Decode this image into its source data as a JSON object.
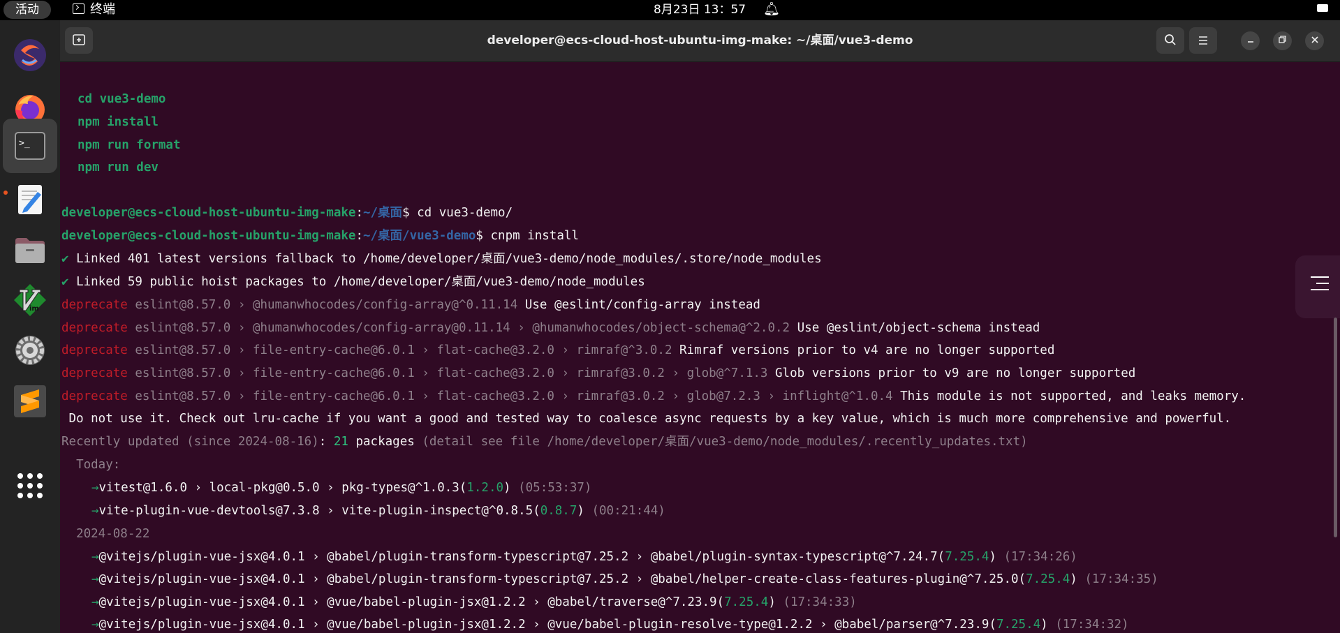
{
  "topbar": {
    "activities": "活动",
    "app_name": "终端",
    "clock": "8月23日  13：57"
  },
  "dock": {
    "items": [
      "sublime-merge",
      "firefox",
      "terminal",
      "text-editor",
      "files",
      "vim",
      "settings",
      "sublime-text",
      "show-apps"
    ]
  },
  "window": {
    "title": "developer@ecs-cloud-host-ubuntu-img-make: ~/桌面/vue3-demo"
  },
  "colors": {
    "terminal_bg": "#300a24",
    "prompt_green": "#26a269",
    "path_blue": "#3465a4",
    "deprecate_red": "#c01c28",
    "dim": "#8e7f8a"
  },
  "terminal": {
    "hint_commands": [
      "cd vue3-demo",
      "npm install",
      "npm run format",
      "npm run dev"
    ],
    "prompt_user": "developer@ecs-cloud-host-ubuntu-img-make",
    "prompt1_path": "~/桌面",
    "cmd1": "cd vue3-demo/",
    "prompt2_path": "~/桌面/vue3-demo",
    "cmd2": "cnpm install",
    "linked": [
      {
        "check": "✔",
        "text": "Linked 401 latest versions fallback to /home/developer/桌面/vue3-demo/node_modules/.store/node_modules"
      },
      {
        "check": "✔",
        "text": "Linked 59 public hoist packages to /home/developer/桌面/vue3-demo/node_modules"
      }
    ],
    "deprecate_label": "deprecate",
    "deprecations": [
      {
        "chain": "eslint@8.57.0 › @humanwhocodes/config-array@^0.11.14",
        "msg": "Use @eslint/config-array instead"
      },
      {
        "chain": "eslint@8.57.0 › @humanwhocodes/config-array@0.11.14 › @humanwhocodes/object-schema@^2.0.2",
        "msg": "Use @eslint/object-schema instead"
      },
      {
        "chain": "eslint@8.57.0 › file-entry-cache@6.0.1 › flat-cache@3.2.0 › rimraf@^3.0.2",
        "msg": "Rimraf versions prior to v4 are no longer supported"
      },
      {
        "chain": "eslint@8.57.0 › file-entry-cache@6.0.1 › flat-cache@3.2.0 › rimraf@3.0.2 › glob@^7.1.3",
        "msg": "Glob versions prior to v9 are no longer supported"
      },
      {
        "chain": "eslint@8.57.0 › file-entry-cache@6.0.1 › flat-cache@3.2.0 › rimraf@3.0.2 › glob@7.2.3 › inflight@^1.0.4",
        "msg": "This module is not supported, and leaks memory."
      }
    ],
    "wrap_line": " Do not use it. Check out lru-cache if you want a good and tested way to coalesce async requests by a key value, which is much more comprehensive and powerful.",
    "recent_prefix": "Recently updated (since 2024-08-16)",
    "recent_colon": ":",
    "recent_count": "21",
    "recent_packages": "packages",
    "recent_detail": "(detail see file /home/developer/桌面/vue3-demo/node_modules/.recently_updates.txt)",
    "today_label": "  Today:",
    "date_label": "  2024-08-22",
    "arrow": "→",
    "updates": [
      {
        "chain": "vitest@1.6.0 › local-pkg@0.5.0 › pkg-types@^1.0.3(",
        "ver": "1.2.0",
        "close": ")",
        "time": " (05:53:37)"
      },
      {
        "chain": "vite-plugin-vue-devtools@7.3.8 › vite-plugin-inspect@^0.8.5(",
        "ver": "0.8.7",
        "close": ")",
        "time": " (00:21:44)"
      },
      {
        "chain": "@vitejs/plugin-vue-jsx@4.0.1 › @babel/plugin-transform-typescript@7.25.2 › @babel/plugin-syntax-typescript@^7.24.7(",
        "ver": "7.25.4",
        "close": ")",
        "time": " (17:34:26)"
      },
      {
        "chain": "@vitejs/plugin-vue-jsx@4.0.1 › @babel/plugin-transform-typescript@7.25.2 › @babel/helper-create-class-features-plugin@^7.25.0(",
        "ver": "7.25.4",
        "close": ")",
        "time": " (17:34:35)"
      },
      {
        "chain": "@vitejs/plugin-vue-jsx@4.0.1 › @vue/babel-plugin-jsx@1.2.2 › @babel/traverse@^7.23.9(",
        "ver": "7.25.4",
        "close": ")",
        "time": " (17:34:33)"
      },
      {
        "chain": "@vitejs/plugin-vue-jsx@4.0.1 › @vue/babel-plugin-jsx@1.2.2 › @vue/babel-plugin-resolve-type@1.2.2 › @babel/parser@^7.23.9(",
        "ver": "7.25.4",
        "close": ")",
        "time": " (17:34:32)"
      }
    ]
  }
}
